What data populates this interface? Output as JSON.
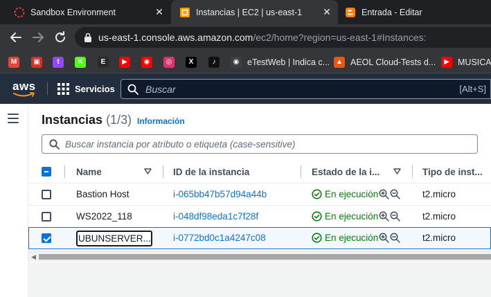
{
  "browser": {
    "tabs": [
      {
        "title": "Sandbox Environment",
        "icon": "sandbox-favicon",
        "active": false
      },
      {
        "title": "Instancias | EC2 | us-east-1",
        "icon": "aws-favicon",
        "active": true
      },
      {
        "title": "Entrada - Editar",
        "icon": "blogger-favicon",
        "active": false
      }
    ],
    "close_glyph": "✕",
    "url_host": "us-east-1.console.aws.amazon.com",
    "url_path": "/ec2/home?region=us-east-1#Instances:",
    "bookmarks": [
      {
        "icon": "gmail-icon",
        "color": "#ea4335",
        "glyph": "M",
        "label": ""
      },
      {
        "icon": "bookmark-red-icon",
        "color": "#d93025",
        "glyph": "▣",
        "label": ""
      },
      {
        "icon": "twitch-icon",
        "color": "#9146ff",
        "glyph": "t",
        "label": ""
      },
      {
        "icon": "kick-icon",
        "color": "#53fc18",
        "glyph": "K",
        "label": ""
      },
      {
        "icon": "epic-icon",
        "color": "#2a2a2a",
        "glyph": "E",
        "label": ""
      },
      {
        "icon": "youtube-icon",
        "color": "#ff0000",
        "glyph": "▶",
        "label": ""
      },
      {
        "icon": "youtube-music-icon",
        "color": "#ff0000",
        "glyph": "◉",
        "label": ""
      },
      {
        "icon": "instagram-icon",
        "color": "#e1306c",
        "glyph": "◎",
        "label": ""
      },
      {
        "icon": "x-icon",
        "color": "#000000",
        "glyph": "X",
        "label": ""
      },
      {
        "icon": "tiktok-icon",
        "color": "#111111",
        "glyph": "♪",
        "label": ""
      },
      {
        "icon": "etestweb-icon",
        "color": "#3c4043",
        "glyph": "◉",
        "label": "eTestWeb | Indica c..."
      },
      {
        "icon": "aeol-icon",
        "color": "#e8590c",
        "glyph": "▲",
        "label": "AEOL Cloud-Tests d..."
      },
      {
        "icon": "youtube-icon",
        "color": "#ff0000",
        "glyph": "▶",
        "label": "MUSICA"
      }
    ]
  },
  "aws": {
    "logo_text": "aws",
    "services_label": "Servicios",
    "search_placeholder": "Buscar",
    "search_shortcut": "[Alt+S]"
  },
  "page": {
    "title": "Instancias",
    "count": "(1/3)",
    "info_link": "Información",
    "filter_placeholder": "Buscar instancia por atributo o etiqueta (case-sensitive)"
  },
  "table": {
    "headers": {
      "name": "Name",
      "instance_id": "ID de la instancia",
      "state": "Estado de la i...",
      "type": "Tipo de inst..."
    },
    "rows": [
      {
        "name": "Bastion Host",
        "instance_id": "i-065bb47b57d94a44b",
        "state": "En ejecución",
        "type": "t2.micro",
        "selected": false
      },
      {
        "name": "WS2022_118",
        "instance_id": "i-048df98eda1c7f28f",
        "state": "En ejecución",
        "type": "t2.micro",
        "selected": false
      },
      {
        "name": "UBUNSERVER...",
        "instance_id": "i-0772bd0c1a4247c08",
        "state": "En ejecución",
        "type": "t2.micro",
        "selected": true
      }
    ]
  },
  "colors": {
    "aws_header": "#232f3e",
    "link": "#0972d3",
    "success": "#037f0c",
    "selection": "#0972d3"
  }
}
